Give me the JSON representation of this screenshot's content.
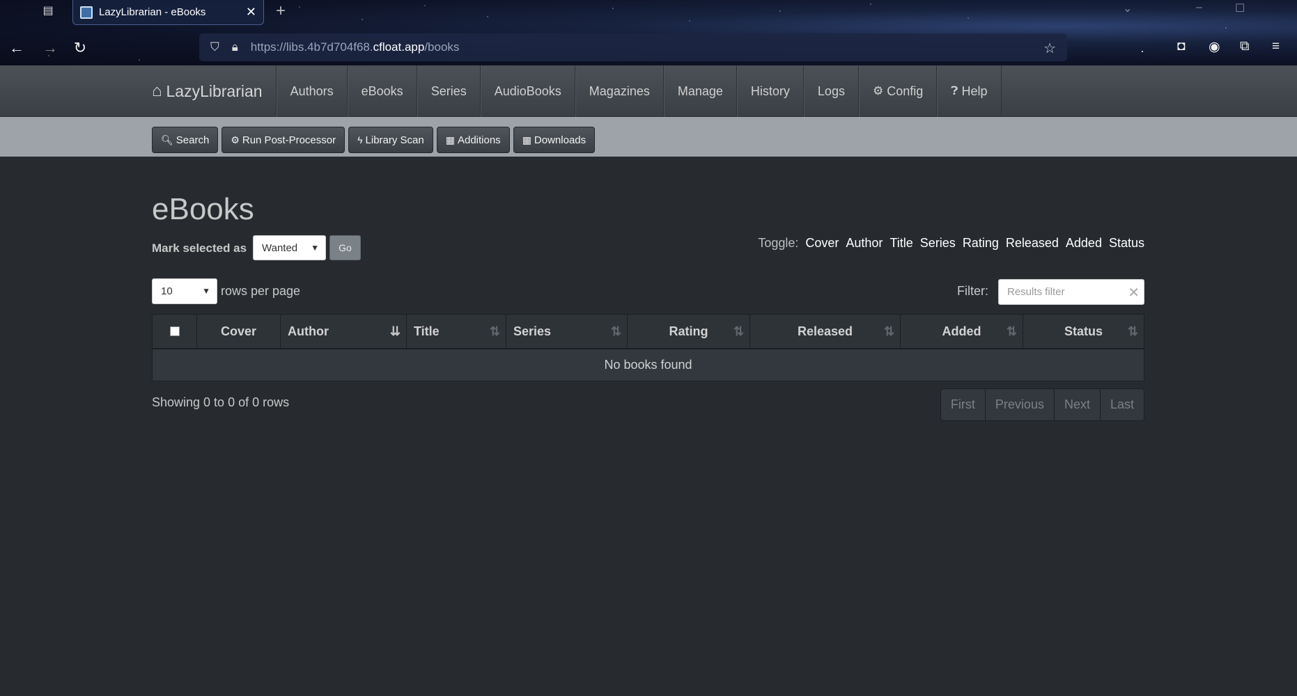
{
  "browser": {
    "tab_title": "LazyLibrarian - eBooks",
    "url_prefix": "https://libs.4b7d704f68.",
    "url_host": "cfloat.app",
    "url_path": "/books"
  },
  "navbar": {
    "brand": "LazyLibrarian",
    "links": [
      "Authors",
      "eBooks",
      "Series",
      "AudioBooks",
      "Magazines",
      "Manage",
      "History",
      "Logs",
      "Config",
      "Help"
    ]
  },
  "toolbar": {
    "search": "Search",
    "postprocessor": "Run Post-Processor",
    "libraryscan": "Library Scan",
    "additions": "Additions",
    "downloads": "Downloads"
  },
  "page": {
    "title": "eBooks",
    "mark_label": "Mark selected as",
    "mark_value": "Wanted",
    "go": "Go",
    "toggle_label": "Toggle:",
    "toggles": [
      "Cover",
      "Author",
      "Title",
      "Series",
      "Rating",
      "Released",
      "Added",
      "Status"
    ],
    "rows_value": "10",
    "rows_label": "rows per page",
    "filter_label": "Filter:",
    "filter_placeholder": "Results filter"
  },
  "table": {
    "columns": [
      "Cover",
      "Author",
      "Title",
      "Series",
      "Rating",
      "Released",
      "Added",
      "Status"
    ],
    "empty_message": "No books found",
    "showing": "Showing 0 to 0 of 0 rows"
  },
  "pager": {
    "first": "First",
    "previous": "Previous",
    "next": "Next",
    "last": "Last"
  }
}
